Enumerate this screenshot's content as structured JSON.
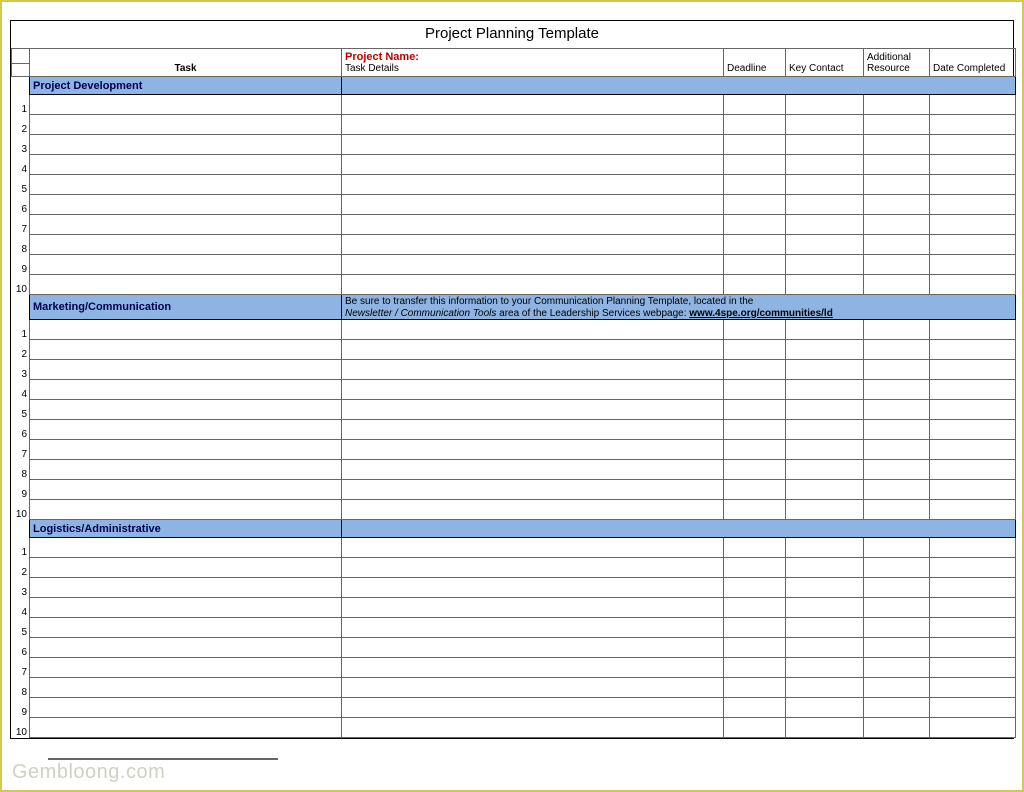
{
  "title": "Project Planning Template",
  "header": {
    "task": "Task",
    "project_name": "Project Name:",
    "task_details": "Task Details",
    "deadline": "Deadline",
    "key_contact": "Key Contact",
    "additional_resource_l1": "Additional",
    "additional_resource_l2": "Resource",
    "date_completed": "Date Completed"
  },
  "sections": [
    {
      "label": "Project Development",
      "note_l1": "",
      "note_l2": "",
      "note_link": "",
      "rows": [
        "1",
        "2",
        "3",
        "4",
        "5",
        "6",
        "7",
        "8",
        "9",
        "10"
      ]
    },
    {
      "label": "Marketing/Communication",
      "note_l1": "Be sure to transfer this information to your Communication Planning Template, located in the",
      "note_l2_italic": "Newsletter / Communication Tools",
      "note_l2_rest": " area of the Leadership Services webpage: ",
      "note_link": "www.4spe.org/communities/ld",
      "rows": [
        "1",
        "2",
        "3",
        "4",
        "5",
        "6",
        "7",
        "8",
        "9",
        "10"
      ]
    },
    {
      "label": "Logistics/Administrative",
      "note_l1": "",
      "note_l2": "",
      "note_link": "",
      "rows": [
        "1",
        "2",
        "3",
        "4",
        "5",
        "6",
        "7",
        "8",
        "9",
        "10"
      ]
    }
  ],
  "watermark": "Gembloong.com"
}
